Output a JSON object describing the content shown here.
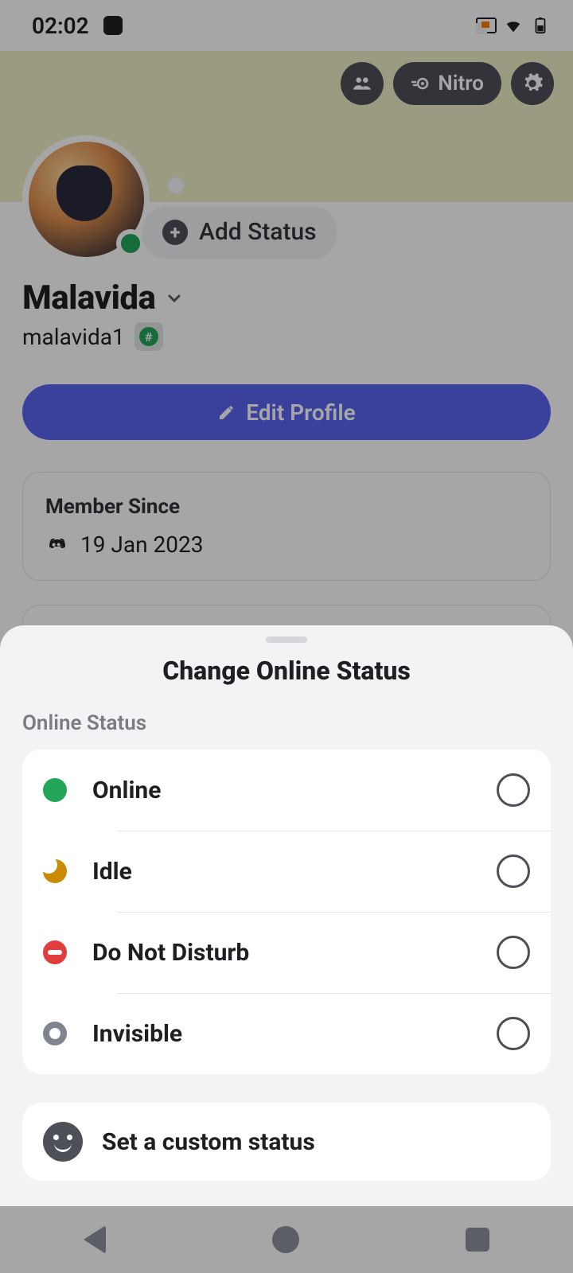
{
  "statusbar": {
    "time": "02:02"
  },
  "header": {
    "nitro_label": "Nitro",
    "add_status_label": "Add Status"
  },
  "profile": {
    "display_name": "Malavida",
    "handle": "malavida1",
    "edit_label": "Edit Profile",
    "member_since_title": "Member Since",
    "member_since_date": "19 Jan 2023"
  },
  "sheet": {
    "title": "Change Online Status",
    "section_label": "Online Status",
    "options": [
      {
        "label": "Online"
      },
      {
        "label": "Idle"
      },
      {
        "label": "Do Not Disturb"
      },
      {
        "label": "Invisible"
      }
    ],
    "custom_status_label": "Set a custom status"
  }
}
